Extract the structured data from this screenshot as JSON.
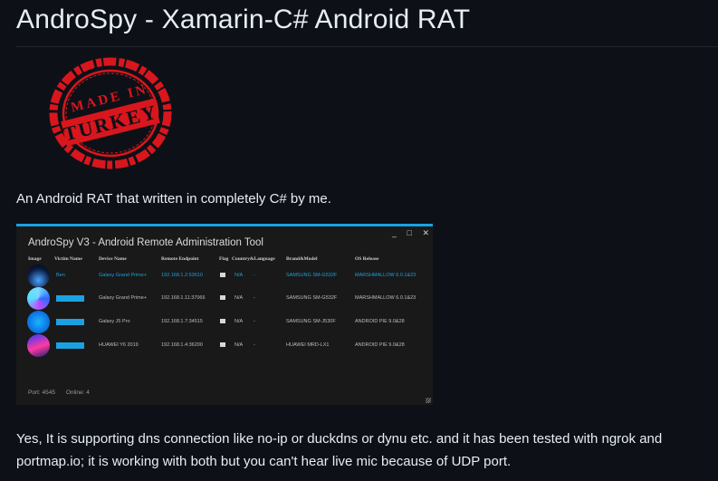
{
  "page": {
    "heading": "AndroSpy - Xamarin-C# Android RAT",
    "logo_text_top": "MADE IN",
    "logo_text_bottom": "TURKEY",
    "intro": "An Android RAT that written in completely C# by me.",
    "description": "Yes, It is supporting dns connection like no-ip or duckdns or dynu etc. and it has been tested with ngrok and portmap.io; it is working with both but you can't hear live mic because of UDP port."
  },
  "app": {
    "title": "AndroSpy V3 - Android Remote Administration Tool",
    "window_buttons": [
      "_",
      "□",
      "✕"
    ],
    "columns": [
      "Image",
      "Victim Name",
      "Device Name",
      "Remote Endpoint",
      "Flag",
      "Country&Language",
      "Brand&Model",
      "OS Release"
    ],
    "rows": [
      {
        "victim": "Ben",
        "device": "Galaxy Grand Prime+",
        "endpoint": "192.168.1.2:53610",
        "flag": "",
        "country": "N/A",
        "lang": "-",
        "brand": "SAMSUNG SM-G532F",
        "os": "MARSHMALLOW  6.0.1&23",
        "selected": true
      },
      {
        "victim": "",
        "device": "Galaxy Grand Prime+",
        "endpoint": "192.168.1.11:37066",
        "flag": "",
        "country": "N/A",
        "lang": "-",
        "brand": "SAMSUNG SM-G532F",
        "os": "MARSHMALLOW  6.0.1&23",
        "selected": false
      },
      {
        "victim": "",
        "device": "Galaxy J5 Pro",
        "endpoint": "192.168.1.7:34515",
        "flag": "",
        "country": "N/A",
        "lang": "-",
        "brand": "SAMSUNG SM-J530F",
        "os": "ANDROID PIE  9.0&28",
        "selected": false
      },
      {
        "victim": "",
        "device": "HUAWEI Y6 2019",
        "endpoint": "192.168.1.4:36200",
        "flag": "",
        "country": "N/A",
        "lang": "-",
        "brand": "HUAWEI MRD-LX1",
        "os": "ANDROID PIE  9.0&28",
        "selected": false
      }
    ],
    "status": {
      "port": "Port: 4545",
      "online": "Online: 4"
    },
    "colors": {
      "accent": "#1ba1e2",
      "logo_red": "#d9161d",
      "background": "#0d1117"
    }
  }
}
